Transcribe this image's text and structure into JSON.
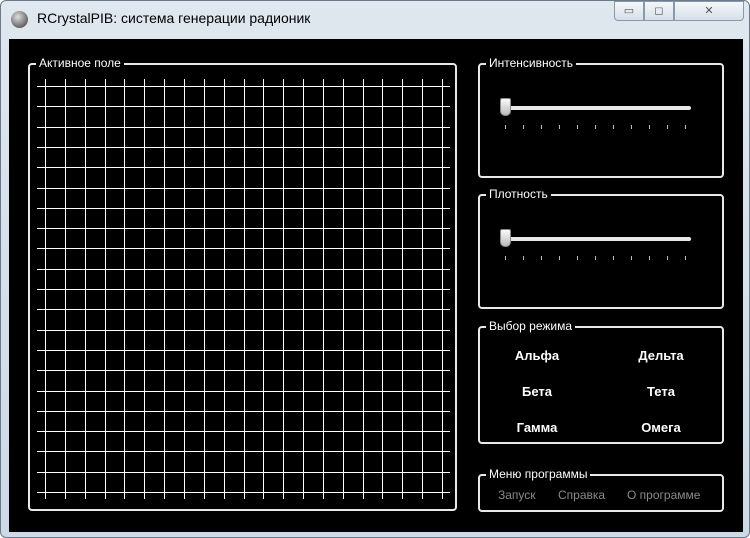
{
  "window": {
    "title": "RCrystalPIB: система генерации радионик",
    "min": "▭",
    "max": "◻",
    "close": "✕"
  },
  "active_field": {
    "label": "Активное поле"
  },
  "intensity": {
    "label": "Интенсивность",
    "value": 0
  },
  "density": {
    "label": "Плотность",
    "value": 0
  },
  "mode": {
    "label": "Выбор режима",
    "items": [
      "Альфа",
      "Дельта",
      "Бета",
      "Тета",
      "Гамма",
      "Омега"
    ]
  },
  "menu": {
    "label": "Меню программы",
    "items": [
      "Запуск",
      "Справка",
      "О программе"
    ]
  }
}
